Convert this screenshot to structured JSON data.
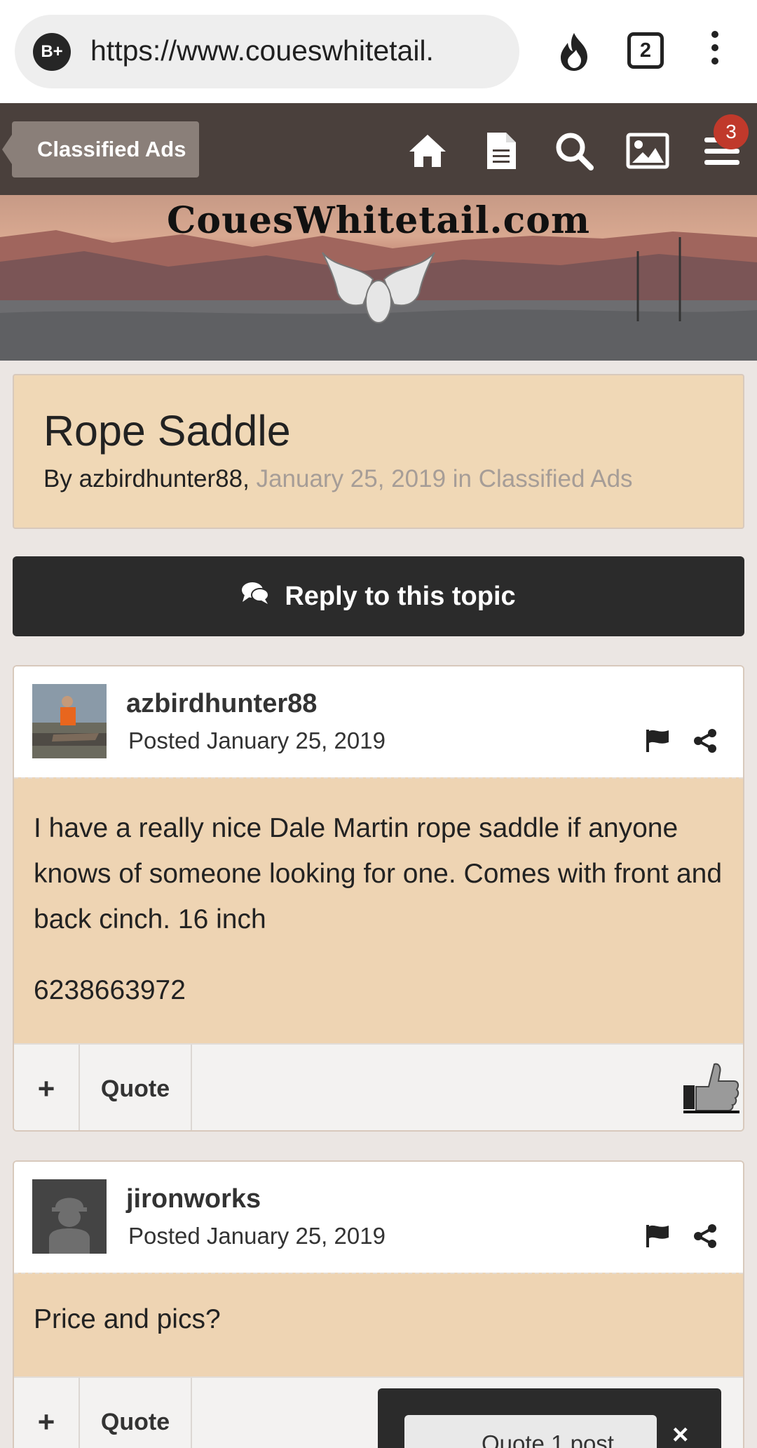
{
  "browser": {
    "site_badge": "B+",
    "url": "https://www.coueswhitetail.",
    "tab_count": "2"
  },
  "nav": {
    "breadcrumb": "Classified Ads",
    "notification_count": "3",
    "icons": [
      "home-icon",
      "document-icon",
      "search-icon",
      "image-icon",
      "menu-icon"
    ]
  },
  "banner": {
    "site_name": "CouesWhitetail.com"
  },
  "topic": {
    "title": "Rope Saddle",
    "by_prefix": "By",
    "author": "azbirdhunter88,",
    "meta": "January 25, 2019 in Classified Ads",
    "reply_label": "Reply to this topic"
  },
  "posts": [
    {
      "author": "azbirdhunter88",
      "posted": "Posted January 25, 2019",
      "body": [
        "I have a really nice Dale Martin rope saddle if anyone knows of someone looking for one. Comes with front and back cinch. 16 inch",
        "6238663972"
      ],
      "plus": "+",
      "quote": "Quote"
    },
    {
      "author": "jironworks",
      "posted": "Posted January 25, 2019",
      "body": [
        "Price and pics?"
      ],
      "plus": "+",
      "quote": "Quote"
    }
  ],
  "quote_popup": {
    "label": "Quote 1 post",
    "close": "×"
  },
  "colors": {
    "nav_bg": "#4a403c",
    "topic_bg": "#f0d8b6",
    "post_body_bg": "#eed4b3",
    "badge": "#c0392b"
  }
}
